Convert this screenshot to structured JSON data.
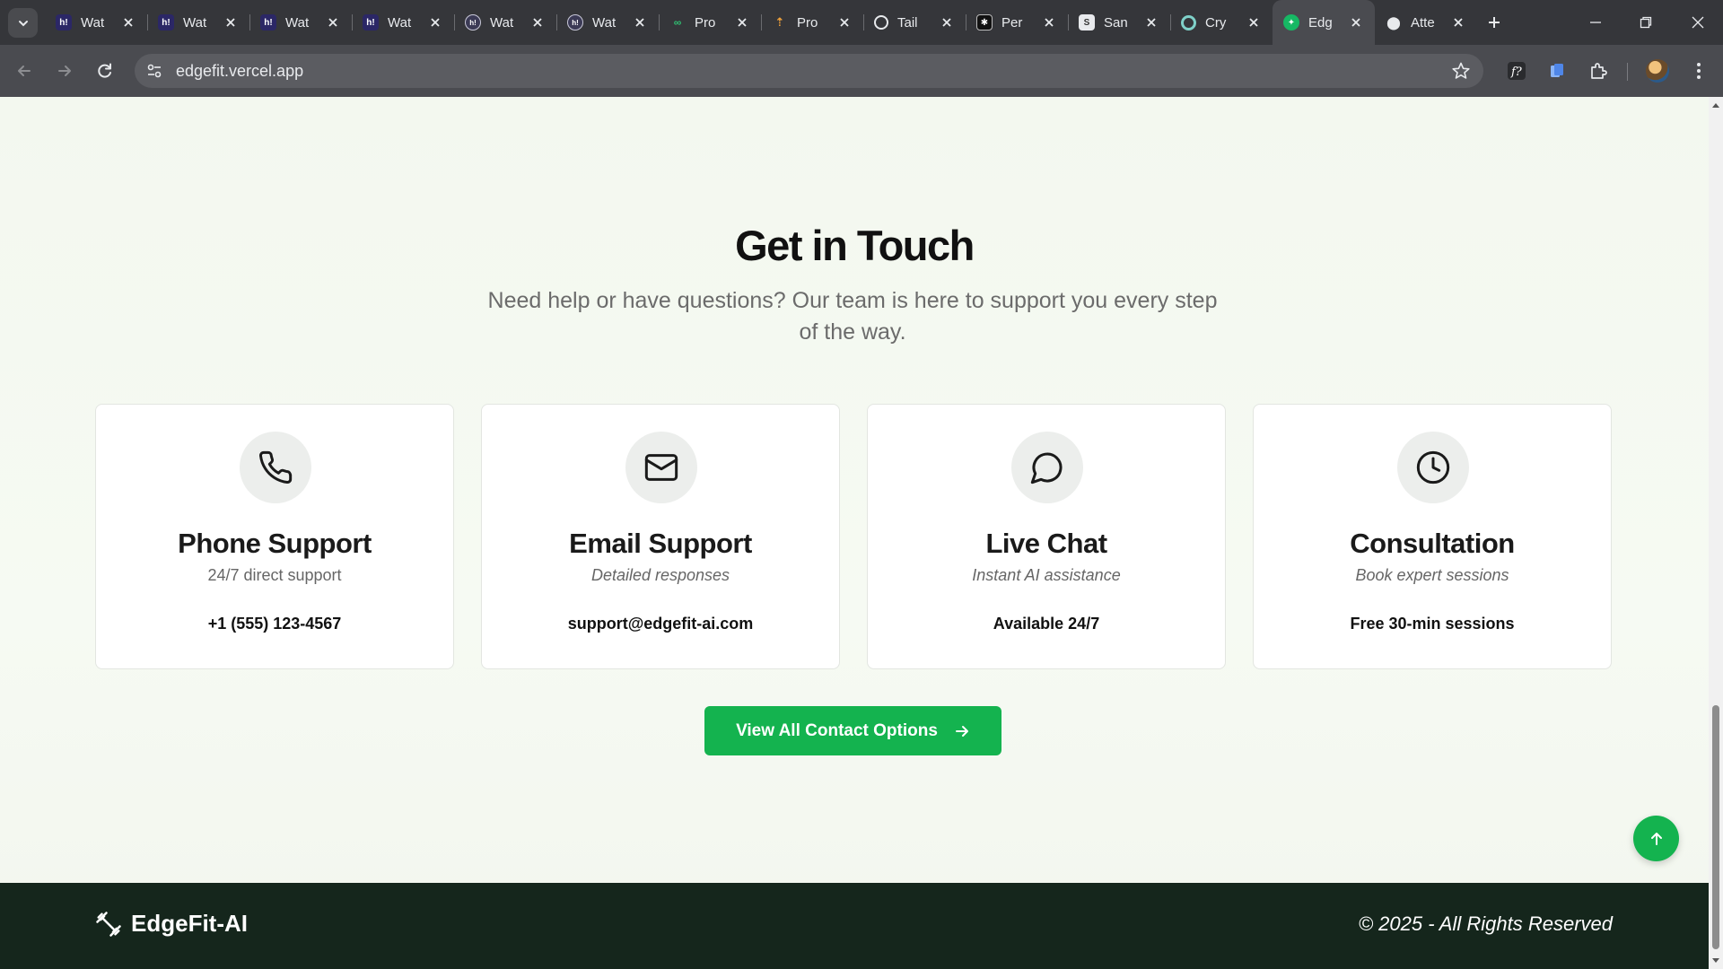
{
  "browser": {
    "tabs": [
      {
        "title": "Wat",
        "icon": "h-logo-icon"
      },
      {
        "title": "Wat",
        "icon": "h-logo-icon"
      },
      {
        "title": "Wat",
        "icon": "h-logo-icon"
      },
      {
        "title": "Wat",
        "icon": "h-logo-icon"
      },
      {
        "title": "Wat",
        "icon": "h-circle-logo-icon"
      },
      {
        "title": "Wat",
        "icon": "h-circle-logo-icon"
      },
      {
        "title": "Pro",
        "icon": "infinity-logo-icon"
      },
      {
        "title": "Pro",
        "icon": "arrow-logo-icon"
      },
      {
        "title": "Tail",
        "icon": "openai-logo-icon"
      },
      {
        "title": "Per",
        "icon": "perplexity-logo-icon"
      },
      {
        "title": "San",
        "icon": "document-logo-icon"
      },
      {
        "title": "Cry",
        "icon": "ring-logo-icon"
      },
      {
        "title": "Edg",
        "icon": "edgefit-logo-icon",
        "active": true
      },
      {
        "title": "Atte",
        "icon": "map-pin-icon"
      }
    ],
    "url": "edgefit.vercel.app"
  },
  "contact": {
    "title": "Get in Touch",
    "subtitle": "Need help or have questions? Our team is here to support you every step of the way.",
    "cards": [
      {
        "icon": "phone-icon",
        "title": "Phone Support",
        "subtitle": "24/7 direct support",
        "value": "+1 (555) 123-4567"
      },
      {
        "icon": "mail-icon",
        "title": "Email Support",
        "subtitle": "Detailed responses",
        "value": "support@edgefit-ai.com"
      },
      {
        "icon": "chat-icon",
        "title": "Live Chat",
        "subtitle": "Instant AI assistance",
        "value": "Available 24/7"
      },
      {
        "icon": "clock-icon",
        "title": "Consultation",
        "subtitle": "Book expert sessions",
        "value": "Free 30-min sessions"
      }
    ],
    "cta_label": "View All Contact Options"
  },
  "footer": {
    "brand": "EdgeFit-AI",
    "copyright": "© 2025 - All Rights Reserved"
  },
  "colors": {
    "accent": "#14b34f",
    "footer_bg": "#15261c",
    "page_bg": "#f3f8ef"
  }
}
